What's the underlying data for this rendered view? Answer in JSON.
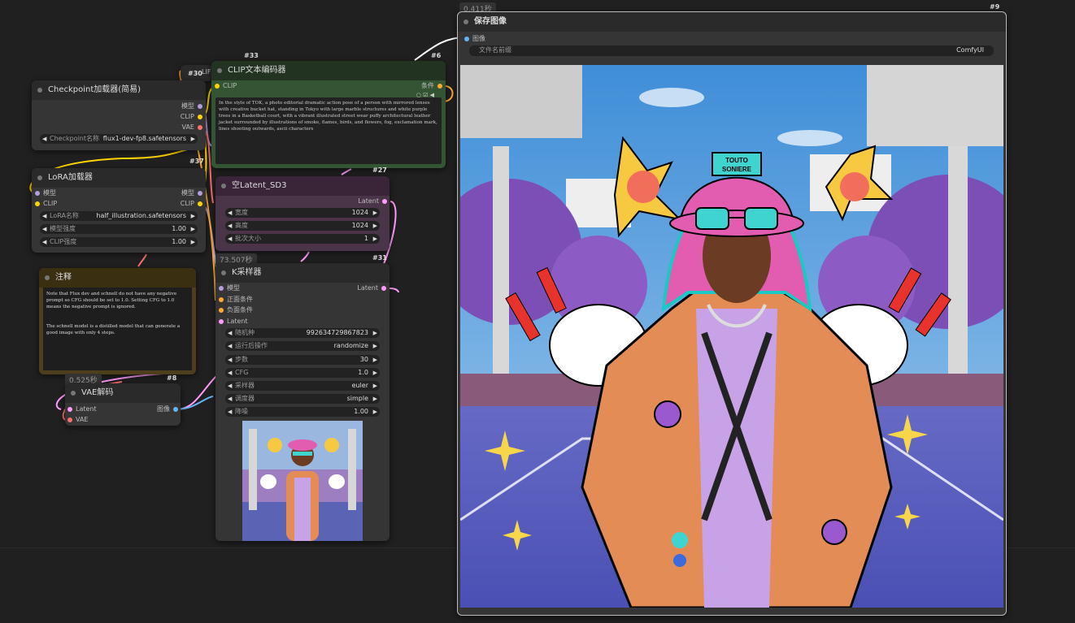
{
  "canvas": {
    "bg": "#202020"
  },
  "colors": {
    "clip": "#ffd500",
    "model": "#b39ddb",
    "vae": "#ff6e6e",
    "conditioning": "#ffa931",
    "latent": "#ff9cf9",
    "image": "#64b5f6"
  },
  "node30": {
    "badge": "#30",
    "title": "LIF"
  },
  "checkpoint": {
    "title": "Checkpoint加载器(简易)",
    "badge": "#37",
    "out_model": "模型",
    "out_clip": "CLIP",
    "out_vae": "VAE",
    "ckpt_label": "Checkpoint名称",
    "ckpt_value": "flux1-dev-fp8.safetensors"
  },
  "lora": {
    "title": "LoRA加载器",
    "in_model": "模型",
    "in_clip": "CLIP",
    "out_model": "模型",
    "out_clip": "CLIP",
    "name_label": "LoRA名称",
    "name_value": "half_illustration.safetensors",
    "model_strength_label": "模型强度",
    "model_strength_value": "1.00",
    "clip_strength_label": "CLIP强度",
    "clip_strength_value": "1.00"
  },
  "note": {
    "title": "注释",
    "text1": "Note that Flux dev and schnell do not have any negative prompt so CFG should be set to 1.0. Setting CFG to 1.0 means the negative prompt is ignored.",
    "text2": "The schnell model is a distilled model that can generate a good image with only 4 steps."
  },
  "vae_decode": {
    "time": "0.525秒",
    "badge": "#8",
    "title": "VAE解码",
    "in_latent": "Latent",
    "in_vae": "VAE",
    "out_image": "图像"
  },
  "clip_encode": {
    "badge": "#33",
    "badge2": "#6",
    "title": "CLIP文本编码器",
    "in_clip": "CLIP",
    "out_cond": "条件",
    "prompt": "In the style of TOK, a photo editorial dramatic action pose of a person with mirrored lenses with creative bucket hat, standing in Tokyo with large marble structures and white purple trees in a Basketball court, with a vibrant illustrated street wear puffy architectural leather jacket surrounded by illustrations of smoke, flames, birds, and flowers, fog, exclamation mark, lines shooting outwards, ascii characters"
  },
  "empty_latent": {
    "badge": "#27",
    "title": "空Latent_SD3",
    "out_latent": "Latent",
    "w_label": "宽度",
    "w_value": "1024",
    "h_label": "高度",
    "h_value": "1024",
    "b_label": "批次大小",
    "b_value": "1"
  },
  "ksampler": {
    "time": "73.507秒",
    "badge": "#31",
    "title": "K采样器",
    "in_model": "模型",
    "in_pos": "正面条件",
    "in_neg": "负面条件",
    "in_latent": "Latent",
    "out_latent": "Latent",
    "widgets": [
      {
        "label": "随机种",
        "value": "992634729867823"
      },
      {
        "label": "运行后操作",
        "value": "randomize"
      },
      {
        "label": "步数",
        "value": "30"
      },
      {
        "label": "CFG",
        "value": "1.0"
      },
      {
        "label": "采样器",
        "value": "euler"
      },
      {
        "label": "调度器",
        "value": "simple"
      },
      {
        "label": "降噪",
        "value": "1.00"
      }
    ]
  },
  "save_image": {
    "time": "0.411秒",
    "badge": "#9",
    "title": "保存图像",
    "in_image": "图像",
    "prefix_label": "文件名前缀",
    "prefix_value": "ComfyUI"
  },
  "preview": {
    "hat_text_1": "TOUTO",
    "hat_text_2": "SONIERE"
  }
}
